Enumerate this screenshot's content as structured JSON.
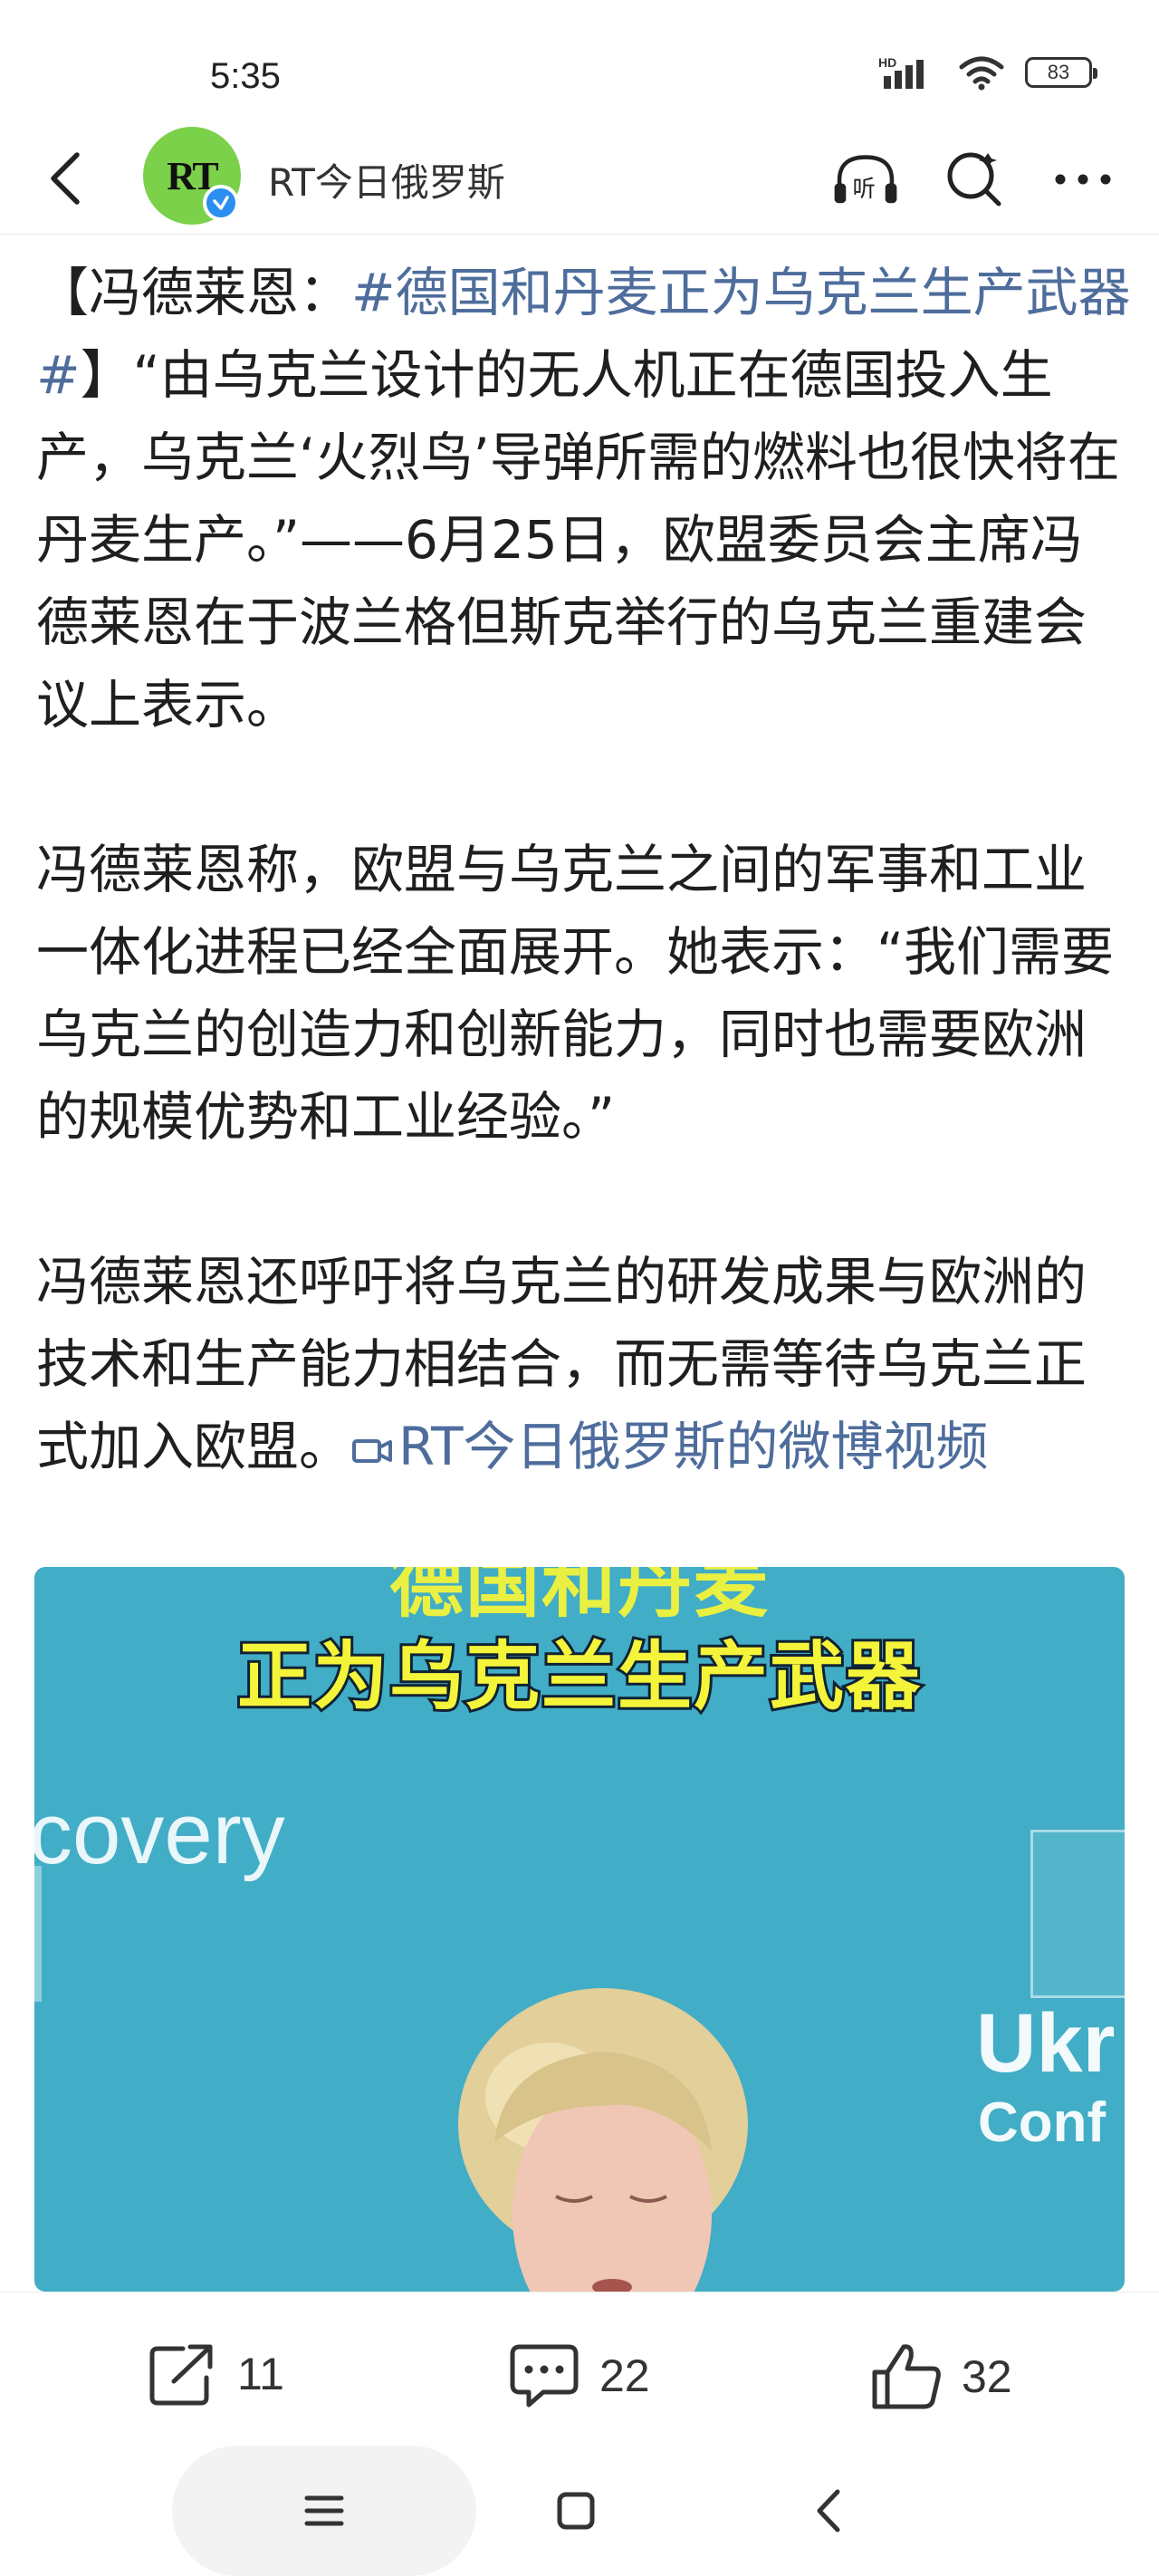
{
  "status_bar": {
    "time": "5:35",
    "network": "HD",
    "battery": "83"
  },
  "header": {
    "account_name": "RT今日俄罗斯",
    "avatar_text": "RT"
  },
  "post": {
    "p1_pre": "【冯德莱恩：",
    "p1_hashtag": "#德国和丹麦正为乌克兰生产武器#",
    "p1_body": "】“由乌克兰设计的无人机正在德国投入生产，乌克兰‘火烈鸟’导弹所需的燃料也很快将在丹麦生产。”——6月25日，欧盟委员会主席冯德莱恩在于波兰格但斯克举行的乌克兰重建会议上表示。",
    "p2": "冯德莱恩称，欧盟与乌克兰之间的军事和工业一体化进程已经全面展开。她表示：“我们需要乌克兰的创造力和创新能力，同时也需要欧洲的规模优势和工业经验。”",
    "p3": "冯德莱恩还呼吁将乌克兰的研发成果与欧洲的技术和生产能力相结合，而无需等待乌克兰正式加入欧盟。",
    "video_link": "RT今日俄罗斯的微博视频"
  },
  "video": {
    "caption_top": "德国和丹麦",
    "caption_main": "正为乌克兰生产武器",
    "bg_text_left": "covery",
    "bg_text_right1": "Ukr",
    "bg_text_right2": "Conf"
  },
  "actions": {
    "repost_count": "11",
    "comment_count": "22",
    "like_count": "32"
  },
  "colors": {
    "link": "#4e6d9c",
    "avatar_bg": "#7bd14a",
    "video_bg": "#41adc6",
    "caption": "#f4f43a"
  },
  "icons": [
    "back-icon",
    "listen-icon",
    "search-icon",
    "more-icon",
    "repost-icon",
    "comment-icon",
    "like-icon",
    "menu-icon",
    "home-icon",
    "nav-back-icon"
  ]
}
